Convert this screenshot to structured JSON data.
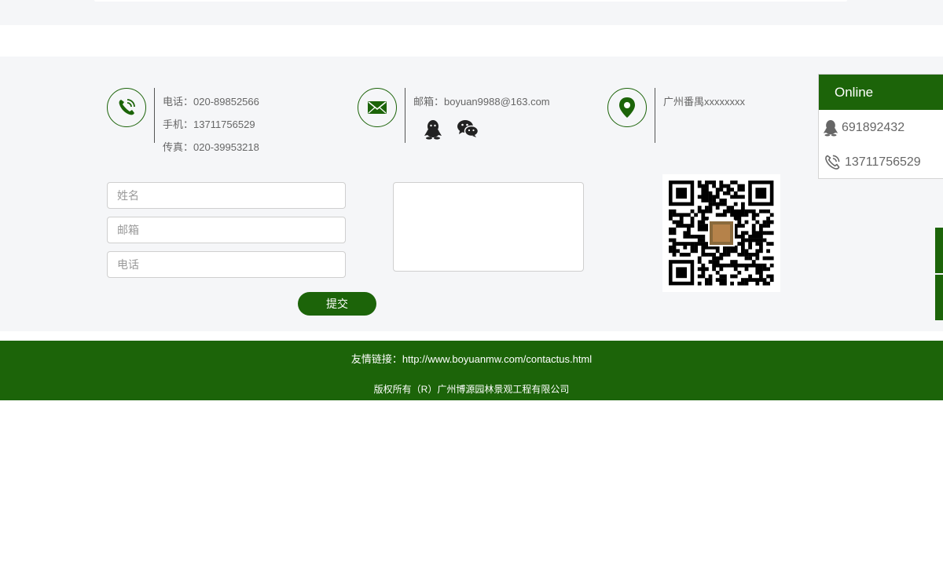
{
  "contact": {
    "phone": "电话：020-89852566",
    "mobile": "手机：13711756529",
    "fax": "传真：020-39953218",
    "email": "邮箱：boyuan9988@163.com",
    "address": "广州番禺xxxxxxxx"
  },
  "form": {
    "name_placeholder": "姓名",
    "email_placeholder": "邮箱",
    "phone_placeholder": "电话",
    "submit_label": "提交"
  },
  "footer": {
    "links": "友情链接：http://www.boyuanmw.com/contactus.html",
    "copyright": "版权所有（R）广州博源园林景观工程有限公司"
  },
  "online": {
    "title": "Online",
    "qq": "691892432",
    "phone": "13711756529"
  },
  "icons": {
    "phone": "phone-icon",
    "mail": "mail-icon",
    "location": "location-pin-icon",
    "qq": "qq-icon",
    "wechat": "wechat-icon",
    "qr": "qr-code"
  },
  "colors": {
    "brand_green": "#1c6409",
    "section_bg": "#f5f6f8"
  }
}
